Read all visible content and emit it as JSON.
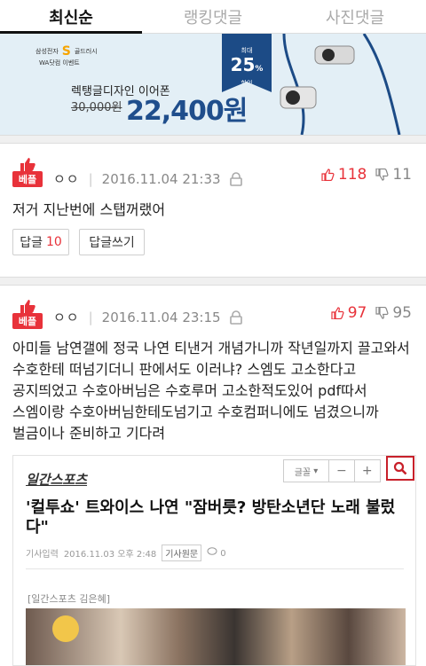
{
  "tabs": [
    {
      "label": "최신순",
      "active": true
    },
    {
      "label": "랭킹댓글",
      "active": false
    },
    {
      "label": "사진댓글",
      "active": false
    }
  ],
  "ad": {
    "brand": "삼성전자",
    "brand_s": "S",
    "brand_suffix": "골드러시",
    "brand_event": "WA닷컴 이벤트",
    "product": "렉탱글디자인 이어폰",
    "old_price": "30,000원",
    "new_price": "22,400원",
    "badge_max": "최대",
    "badge_pct": "25",
    "badge_pct_unit": "%",
    "badge_sale": "할인"
  },
  "comments": [
    {
      "best_label": "베플",
      "nick": "ㅇㅇ",
      "date": "2016.11.04 21:33",
      "up": "118",
      "down": "11",
      "text": "저거 지난번에 스탭꺼랬어",
      "reply_label": "답글",
      "reply_count": "10",
      "write_label": "답글쓰기"
    },
    {
      "best_label": "베플",
      "nick": "ㅇㅇ",
      "date": "2016.11.04 23:15",
      "up": "97",
      "down": "95",
      "text": "아미들 남연갤에 정국 나연 티낸거 개념가니까 작년일까지 끌고와서 수호한테 떠넘기더니 판에서도 이러냐? 스엠도 고소한다고 공지띄었고 수호아버님은 수호루머 고소한적도있어 pdf따서 스엠이랑 수호아버님한테도넘기고 수호컴퍼니에도 넘겼으니까 벌금이나 준비하고 기다려"
    }
  ],
  "embed": {
    "logo": "일간스포츠",
    "tool_font": "글꼴",
    "tool_minus": "−",
    "tool_plus": "+",
    "headline": "'컬투쇼' 트와이스 나연 \"잠버릇? 방탄소년단 노래 불렀다\"",
    "date_label": "기사입력",
    "date": "2016.11.03 오후 2:48",
    "origin": "기사원문",
    "comments_count": "0",
    "byline": "[일간스포츠 김은혜]"
  },
  "colors": {
    "accent_red": "#e8323a",
    "ad_blue": "#1f4e8c",
    "ad_bg": "#e3eff6"
  }
}
